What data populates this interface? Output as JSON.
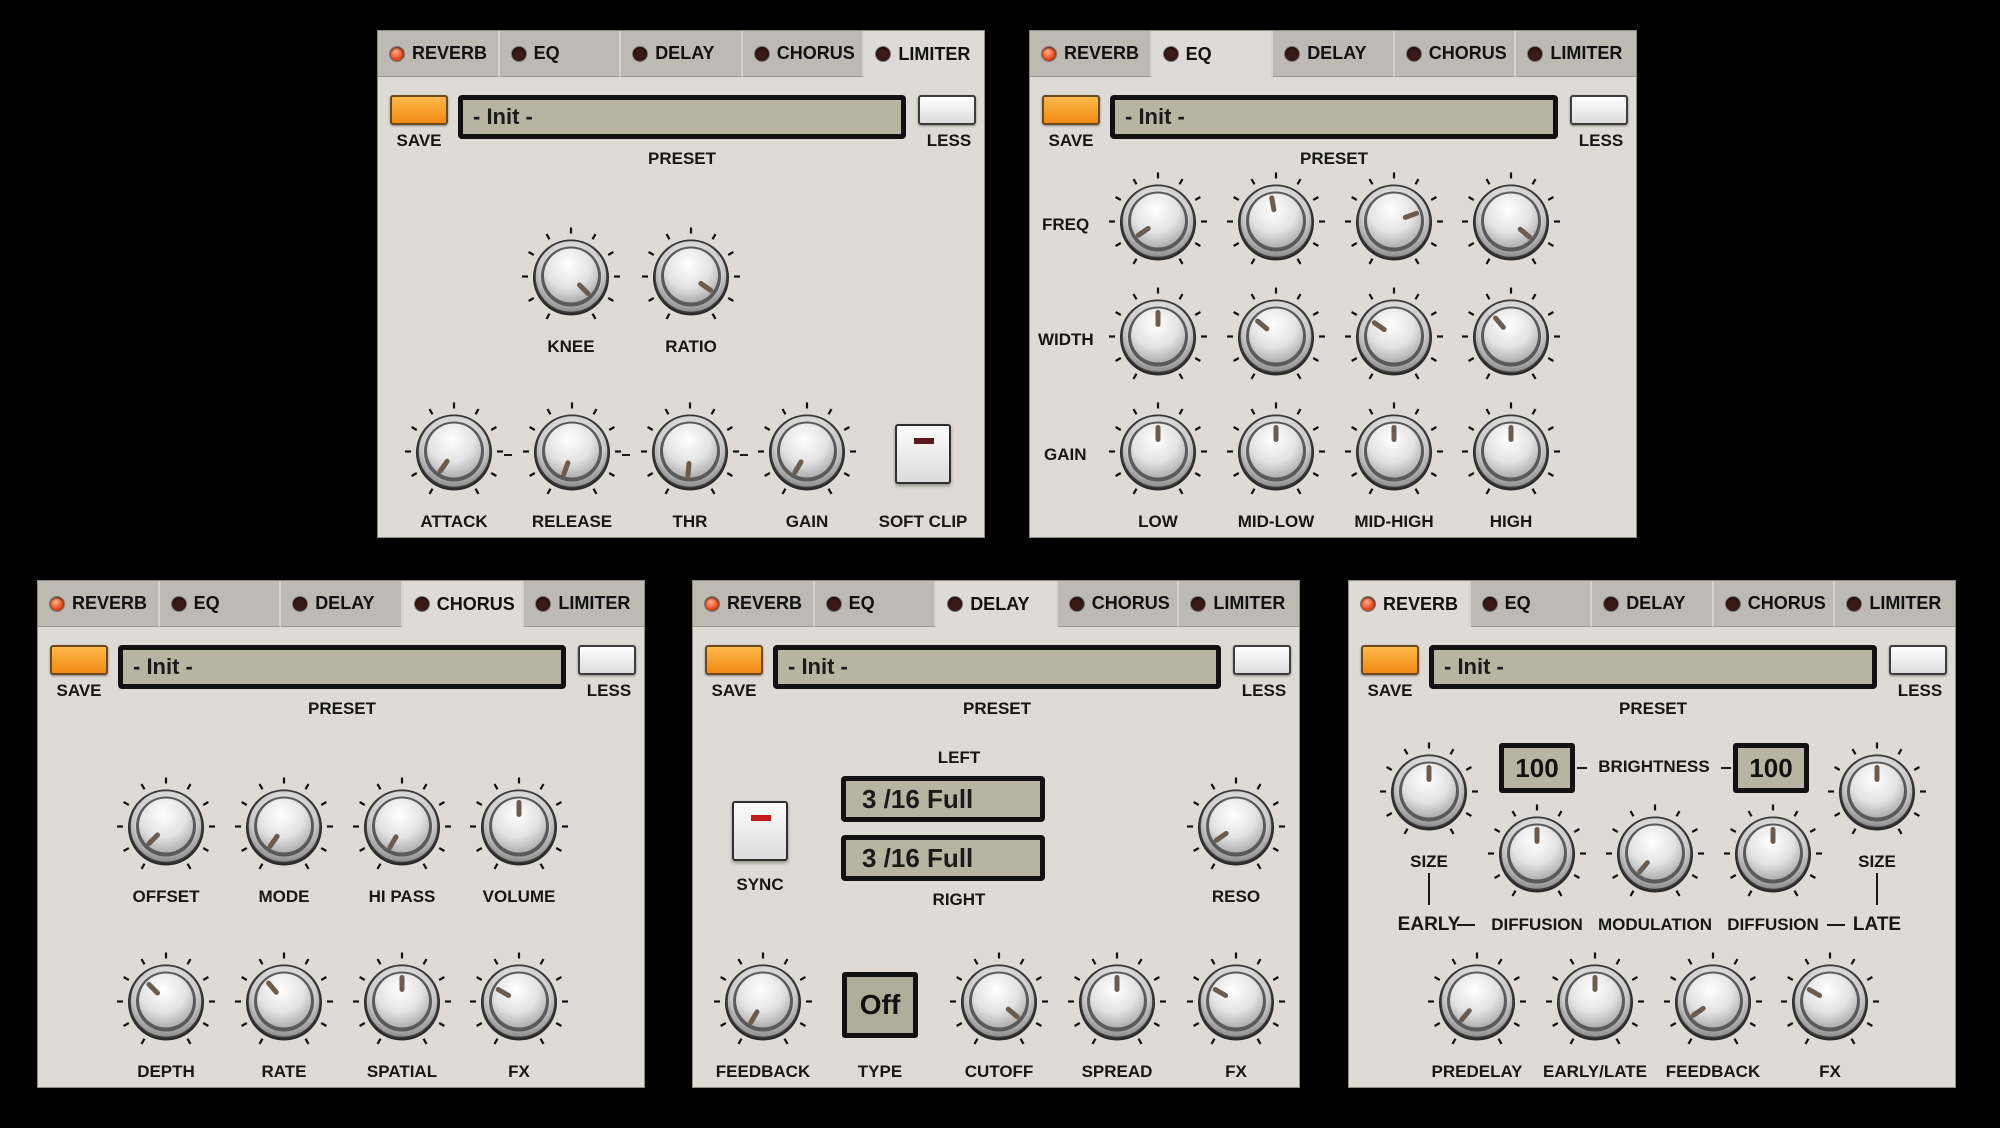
{
  "tabs": [
    "REVERB",
    "EQ",
    "DELAY",
    "CHORUS",
    "LIMITER"
  ],
  "common": {
    "save": "SAVE",
    "less": "LESS",
    "preset_label": "PRESET",
    "preset_value": "- Init -"
  },
  "colors": {
    "panel": "#dedbd6",
    "tab_inactive": "#bdbab4",
    "led_on": "#e8491c",
    "save_orange": "#f59a20",
    "lcd": "#b8b4a2"
  },
  "limiter": {
    "knobs_top": [
      "KNEE",
      "RATIO"
    ],
    "knobs_bottom": [
      "ATTACK",
      "RELEASE",
      "THR",
      "GAIN"
    ],
    "soft_clip": "SOFT CLIP"
  },
  "eq": {
    "rows": [
      "FREQ",
      "WIDTH",
      "GAIN"
    ],
    "bands": [
      "LOW",
      "MID-LOW",
      "MID-HIGH",
      "HIGH"
    ]
  },
  "chorus": {
    "knobs_top": [
      "OFFSET",
      "MODE",
      "HI PASS",
      "VOLUME"
    ],
    "knobs_bottom": [
      "DEPTH",
      "RATE",
      "SPATIAL",
      "FX"
    ]
  },
  "delay": {
    "left_label": "LEFT",
    "right_label": "RIGHT",
    "left_value": "3 /16   Full",
    "right_value": "3 /16   Full",
    "sync": "SYNC",
    "reso": "RESO",
    "type_value": "Off",
    "type_label": "TYPE",
    "knobs_bottom": [
      "FEEDBACK",
      "CUTOFF",
      "SPREAD",
      "FX"
    ]
  },
  "reverb": {
    "brightness": "BRIGHTNESS",
    "brightness_left": "100",
    "brightness_right": "100",
    "size": "SIZE",
    "diffusion": "DIFFUSION",
    "modulation": "MODULATION",
    "early": "EARLY",
    "late": "LATE",
    "knobs_bottom": [
      "PREDELAY",
      "EARLY/LATE",
      "FEEDBACK",
      "FX"
    ]
  }
}
